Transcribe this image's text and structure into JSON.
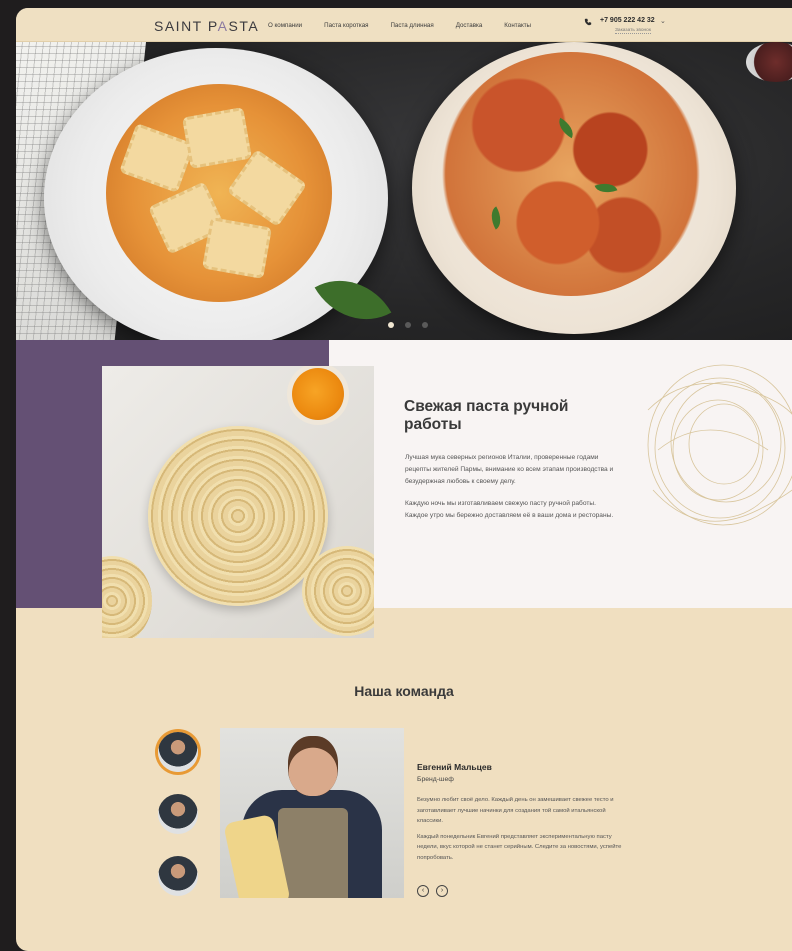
{
  "header": {
    "logo_part1": "SAINT P",
    "logo_accent": "A",
    "logo_part2": "STA",
    "nav": [
      "О компании",
      "Паста короткая",
      "Паста длинная",
      "Доставка",
      "Контакты"
    ],
    "phone": "+7 905 222 42 32",
    "callback": "Заказать звонок"
  },
  "hero": {
    "slides": 3,
    "active_slide": 1
  },
  "about": {
    "title": "Свежая паста ручной работы",
    "paragraph1": "Лучшая мука северных регионов Италии, проверенные годами рецепты жителей Пармы, внимание ко всем этапам производства и безудержная любовь к своему делу.",
    "paragraph2": "Каждую ночь мы изготавливаем свежую пасту ручной работы. Каждое утро мы бережно доставляем её в ваши дома и рестораны."
  },
  "team": {
    "title": "Наша команда",
    "member": {
      "name": "Евгений Мальцев",
      "role": "Бренд-шеф",
      "bio1": "Безумно любит своё дело. Каждый день он замешивает свежее тесто и заготавливает лучшие начинки для создания той самой итальянской классики.",
      "bio2": "Каждый понедельник Евгений представляет экспериментальную пасту недели, вкус которой не станет серийным. Следите за новостями, успейте попробовать."
    },
    "prev_arrow": "‹",
    "next_arrow": "›"
  },
  "colors": {
    "beige": "#f0dfc0",
    "purple": "#645074",
    "accent_orange": "#e89a35"
  }
}
